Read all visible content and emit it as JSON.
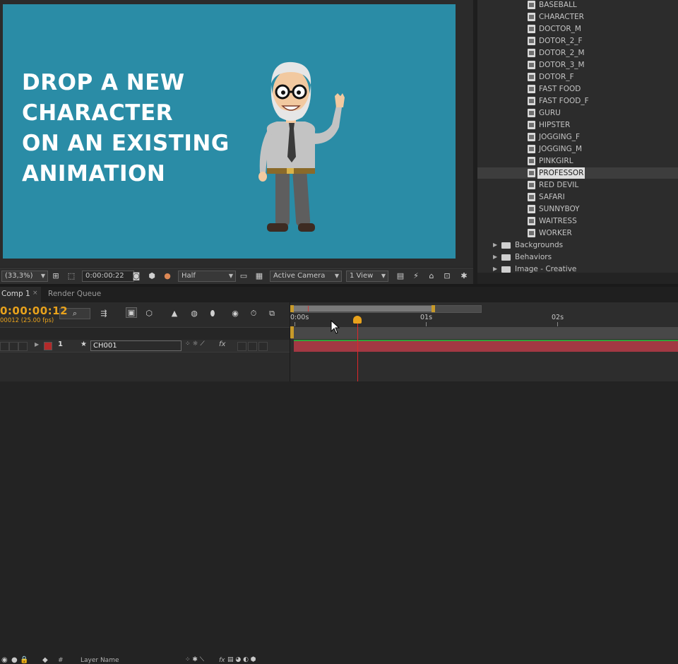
{
  "headline": {
    "lines": [
      "DROP A NEW",
      "CHARACTER",
      "ON AN EXISTING",
      "ANIMATION"
    ]
  },
  "viewer_toolbar": {
    "zoom": "(33,3%)",
    "timecode": "0:00:00:22",
    "resolution": "Half",
    "camera": "Active Camera",
    "view": "1 View"
  },
  "project": {
    "items": [
      "BASEBALL",
      "CHARACTER",
      "DOCTOR_M",
      "DOTOR_2_F",
      "DOTOR_2_M",
      "DOTOR_3_M",
      "DOTOR_F",
      "FAST FOOD",
      "FAST FOOD_F",
      "GURU",
      "HIPSTER",
      "JOGGING_F",
      "JOGGING_M",
      "PINKGIRL",
      "PROFESSOR",
      "RED DEVIL",
      "SAFARI",
      "SUNNYBOY",
      "WAITRESS",
      "WORKER"
    ],
    "selected": "PROFESSOR",
    "folders": [
      "Backgrounds",
      "Behaviors",
      "Image - Creative"
    ]
  },
  "timeline": {
    "tabs": [
      "Comp 1",
      "Render Queue"
    ],
    "current_time": "0:00:00:12",
    "frame_info": "00012 (25.00 fps)",
    "layer_name_header": "Layer Name",
    "number_header": "#",
    "layer": {
      "index": "1",
      "name": "CH001"
    },
    "ruler_labels": [
      "0:00s",
      "01s",
      "02s"
    ],
    "fx_label": "fx"
  },
  "colors": {
    "canvas_bg": "#2a8ca6",
    "accent_orange": "#e8a21c",
    "layer_bar": "#a23843",
    "playhead": "#e0272a"
  }
}
